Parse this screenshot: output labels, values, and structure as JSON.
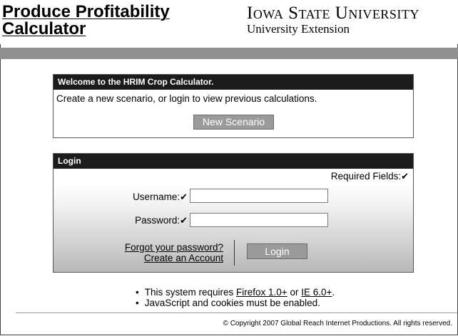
{
  "header": {
    "app_title_line1": "Produce Profitability",
    "app_title_line2": "Calculator",
    "university": "Iowa State University",
    "extension": "University Extension"
  },
  "welcome": {
    "title": "Welcome to the HRIM Crop Calculator.",
    "text": "Create a new scenario, or login to view previous calculations.",
    "new_scenario_label": "New Scenario"
  },
  "login": {
    "title": "Login",
    "required_fields": "Required Fields:",
    "check": "✔",
    "username_label": "Username:",
    "password_label": "Password:",
    "username_value": "",
    "password_value": "",
    "forgot_password": "Forgot your password?",
    "create_account": "Create an Account",
    "login_label": "Login"
  },
  "requirements": {
    "line1_prefix": "This system requires ",
    "firefox": "Firefox 1.0+",
    "or": " or ",
    "ie": "IE 6.0+",
    "period": ".",
    "line2": "JavaScript and cookies must be enabled."
  },
  "footer": {
    "copyright": "© Copyright 2007 Global Reach Internet Productions. All rights reserved."
  },
  "colors": {
    "title_bar": "#1c1c1c",
    "grey_bar": "#909090",
    "button": "#9a9a9a"
  }
}
